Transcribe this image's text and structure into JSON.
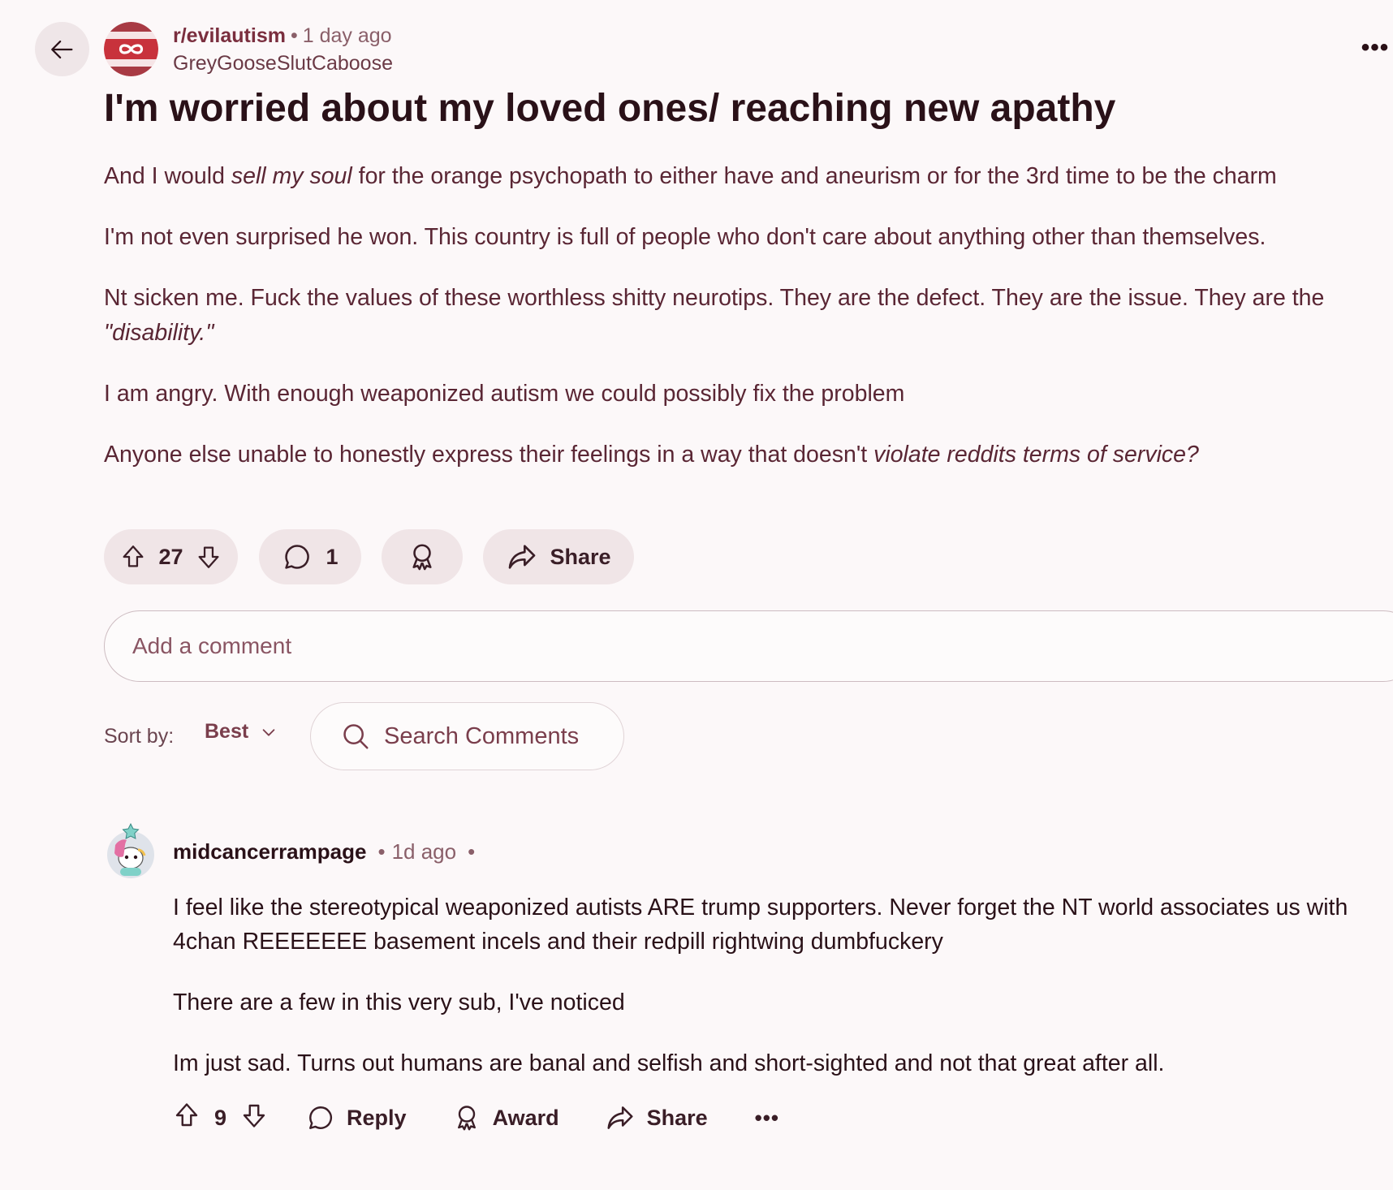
{
  "post": {
    "subreddit": "r/evilautism",
    "time": "1 day ago",
    "author": "GreyGooseSlutCaboose",
    "title": "I'm worried about my loved ones/ reaching new apathy",
    "body": {
      "p1_a": "And I would ",
      "p1_em": "sell my soul",
      "p1_b": " for the orange psychopath to either have and aneurism or for the 3rd time to be the charm",
      "p2": "I'm not even surprised he won. This country is full of people who don't care about anything other than themselves.",
      "p3_a": "Nt sicken me. Fuck the values of these worthless shitty neurotips. They are the defect. They are the issue. They are the ",
      "p3_em": "\"disability.\"",
      "p4": "I am angry. With enough weaponized autism we could possibly fix the problem",
      "p5_a": "Anyone else unable to honestly express their feelings in a way that doesn't ",
      "p5_em": "violate reddits terms of service?"
    },
    "votes": "27",
    "comments": "1",
    "share_label": "Share"
  },
  "add_comment": {
    "placeholder": "Add a comment"
  },
  "sort": {
    "label": "Sort by:",
    "value": "Best"
  },
  "search_comments": {
    "placeholder": "Search Comments"
  },
  "comment": {
    "username": "midcancerrampage",
    "time": "1d ago",
    "paragraphs": [
      "I feel like the stereotypical weaponized autists ARE trump supporters. Never forget the NT world associates us with 4chan REEEEEEE basement incels and their redpill rightwing dumbfuckery",
      "There are a few in this very sub, I've noticed",
      "Im just sad. Turns out humans are banal and selfish and short-sighted and not that great after all."
    ],
    "votes": "9",
    "reply_label": "Reply",
    "award_label": "Award",
    "share_label": "Share"
  },
  "icons": {
    "back": "arrow-left-icon",
    "more": "ellipsis-icon",
    "upvote": "arrow-up-icon",
    "downvote": "arrow-down-icon",
    "comment": "speech-bubble-icon",
    "award": "award-ribbon-icon",
    "share": "share-arrow-icon",
    "search": "search-icon",
    "chevron": "chevron-down-icon"
  },
  "colors": {
    "background": "#fcf8f9",
    "pill_bg": "#f0e5e7",
    "title": "#2a1118",
    "body_text": "#5a2634",
    "accent": "#7a2e3e",
    "subreddit_icon_red": "#c8323c"
  }
}
